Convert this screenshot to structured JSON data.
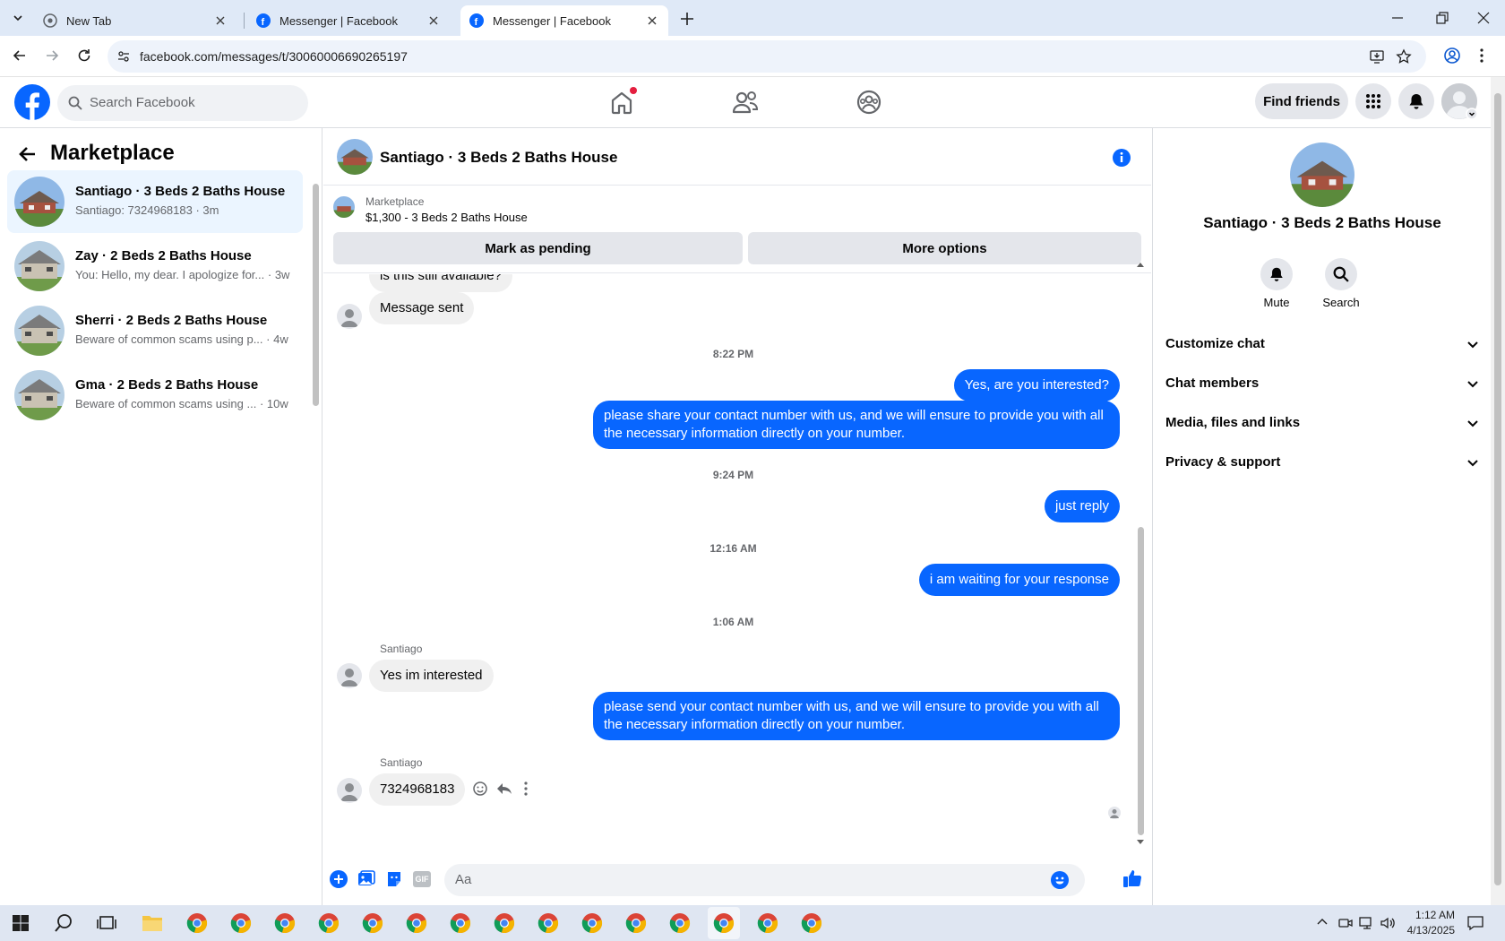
{
  "browser": {
    "tabs": [
      {
        "label": "New Tab",
        "icon": "chrome-icon"
      },
      {
        "label": "Messenger | Facebook",
        "icon": "facebook-icon"
      },
      {
        "label": "Messenger | Facebook",
        "icon": "facebook-icon"
      }
    ],
    "url": "facebook.com/messages/t/30060006690265197"
  },
  "header": {
    "search_placeholder": "Search Facebook",
    "find_friends": "Find friends"
  },
  "left": {
    "title": "Marketplace",
    "conversations": [
      {
        "title": "Santiago · 3 Beds 2 Baths House",
        "preview": "Santiago: 7324968183",
        "time": "· 3m"
      },
      {
        "title": "Zay · 2 Beds 2 Baths House",
        "preview": "You: Hello, my dear. I apologize for...",
        "time": "· 3w"
      },
      {
        "title": "Sherri · 2 Beds 2 Baths House",
        "preview": "Beware of common scams using p...",
        "time": "· 4w"
      },
      {
        "title": "Gma · 2 Beds 2 Baths House",
        "preview": "Beware of common scams using ...",
        "time": "· 10w"
      }
    ]
  },
  "chat": {
    "title": "Santiago · 3 Beds 2 Baths House",
    "marketplace_label": "Marketplace",
    "listing": "$1,300 - 3 Beds 2 Baths House",
    "mark_pending": "Mark as pending",
    "more_options": "More options",
    "partial_message": "is this still available?",
    "messages": {
      "m1": "Message sent",
      "t1": "8:22 PM",
      "m2": "Yes, are you interested?",
      "m3": "please share your contact number with us, and we will ensure to provide you with all the necessary information directly on your number.",
      "t2": "9:24 PM",
      "m4": "just reply",
      "t3": "12:16 AM",
      "m5": "i am waiting for your response",
      "t4": "1:06 AM",
      "sender1": "Santiago",
      "m6": "Yes im interested",
      "m7": "please send your contact number with us, and we will ensure to provide you with all the necessary information directly on your number.",
      "sender2": "Santiago",
      "m8": "7324968183"
    },
    "input_placeholder": "Aa"
  },
  "right": {
    "title": "Santiago · 3 Beds 2 Baths House",
    "mute": "Mute",
    "search": "Search",
    "sections": [
      "Customize chat",
      "Chat members",
      "Media, files and links",
      "Privacy & support"
    ]
  },
  "taskbar": {
    "time": "1:12 AM",
    "date": "4/13/2025"
  },
  "colors": {
    "accent": "#0866ff",
    "selected_conv": "#ebf5ff",
    "notification_dot": "#e41e3f"
  }
}
